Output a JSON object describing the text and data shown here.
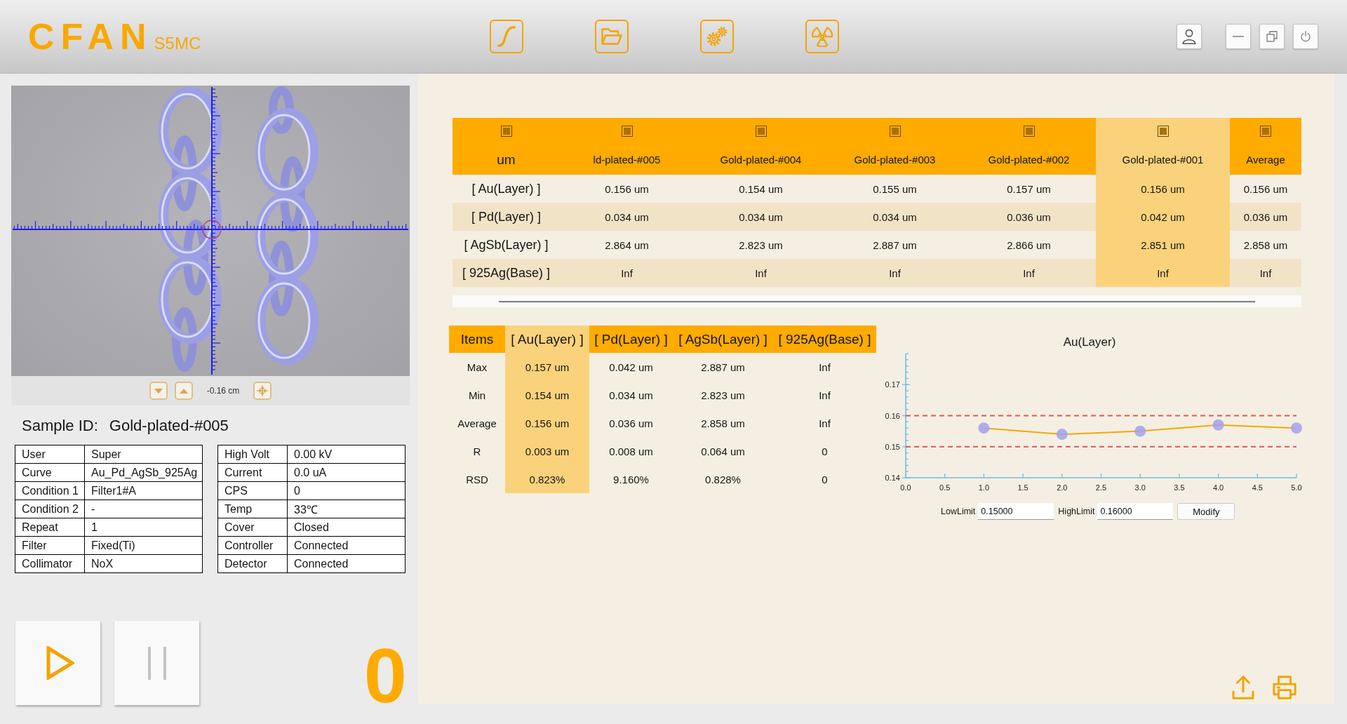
{
  "header": {
    "brand": "CFAN",
    "model": "S5MC"
  },
  "camera": {
    "offset": "-0.16 cm"
  },
  "sample": {
    "label": "Sample ID:",
    "value": "Gold-plated-#005"
  },
  "info_left": [
    {
      "label": "User",
      "value": "Super"
    },
    {
      "label": "Curve",
      "value": "Au_Pd_AgSb_925Ag"
    },
    {
      "label": "Condition 1",
      "value": "Filter1#A"
    },
    {
      "label": "Condition 2",
      "value": "-"
    },
    {
      "label": "Repeat",
      "value": "1"
    },
    {
      "label": "Filter",
      "value": "Fixed(Ti)"
    },
    {
      "label": "Collimator",
      "value": "NoX"
    }
  ],
  "info_right": [
    {
      "label": "High Volt",
      "value": "0.00 kV"
    },
    {
      "label": "Current",
      "value": "0.0 uA"
    },
    {
      "label": "CPS",
      "value": "0"
    },
    {
      "label": "Temp",
      "value": "33℃"
    },
    {
      "label": "Cover",
      "value": "Closed"
    },
    {
      "label": "Controller",
      "value": "Connected"
    },
    {
      "label": "Detector",
      "value": "Connected"
    }
  ],
  "run_controls": [
    {
      "kind": "play",
      "disabled": false
    },
    {
      "kind": "pause",
      "disabled": true
    }
  ],
  "counter": "0",
  "results_table": {
    "columns": [
      {
        "label": "um",
        "checked": true,
        "selected": false
      },
      {
        "label": "ld-plated-#005",
        "checked": true,
        "selected": false
      },
      {
        "label": "Gold-plated-#004",
        "checked": true,
        "selected": false
      },
      {
        "label": "Gold-plated-#003",
        "checked": true,
        "selected": false
      },
      {
        "label": "Gold-plated-#002",
        "checked": true,
        "selected": false
      },
      {
        "label": "Gold-plated-#001",
        "checked": true,
        "selected": true
      },
      {
        "label": "Average",
        "checked": true,
        "selected": false
      }
    ],
    "rows": [
      {
        "label": "[ Au(Layer) ]",
        "values": [
          "0.156 um",
          "0.154 um",
          "0.155 um",
          "0.157 um",
          "0.156 um",
          "0.156 um"
        ]
      },
      {
        "label": "[ Pd(Layer) ]",
        "values": [
          "0.034 um",
          "0.034 um",
          "0.034 um",
          "0.036 um",
          "0.042 um",
          "0.036 um"
        ]
      },
      {
        "label": "[ AgSb(Layer) ]",
        "values": [
          "2.864 um",
          "2.823 um",
          "2.887 um",
          "2.866 um",
          "2.851 um",
          "2.858 um"
        ]
      },
      {
        "label": "[ 925Ag(Base) ]",
        "values": [
          "Inf",
          "Inf",
          "Inf",
          "Inf",
          "Inf",
          "Inf"
        ]
      }
    ]
  },
  "stats_table": {
    "columns": [
      {
        "label": "Items",
        "selected": false
      },
      {
        "label": "[ Au(Layer) ]",
        "selected": true
      },
      {
        "label": "[ Pd(Layer) ]",
        "selected": false
      },
      {
        "label": "[ AgSb(Layer) ]",
        "selected": false
      },
      {
        "label": "[ 925Ag(Base) ]",
        "selected": false
      }
    ],
    "rows": [
      {
        "label": "Max",
        "values": [
          "0.157 um",
          "0.042 um",
          "2.887 um",
          "Inf"
        ]
      },
      {
        "label": "Min",
        "values": [
          "0.154 um",
          "0.034 um",
          "2.823 um",
          "Inf"
        ]
      },
      {
        "label": "Average",
        "values": [
          "0.156 um",
          "0.036 um",
          "2.858 um",
          "Inf"
        ]
      },
      {
        "label": "R",
        "values": [
          "0.003 um",
          "0.008 um",
          "0.064 um",
          "0"
        ]
      },
      {
        "label": "RSD",
        "values": [
          "0.823%",
          "9.160%",
          "0.828%",
          "0"
        ]
      }
    ]
  },
  "chart": {
    "chart_data": {
      "type": "line",
      "title": "Au(Layer)",
      "x": [
        1,
        2,
        3,
        4,
        5
      ],
      "series": [
        {
          "color": "#f5a800",
          "marker": "circle",
          "values": [
            0.156,
            0.154,
            0.155,
            0.157,
            0.156
          ]
        }
      ],
      "xlim": [
        0,
        5
      ],
      "ylim": [
        0.14,
        0.18
      ],
      "xticks": [
        {
          "value": 0,
          "label": "0.0"
        },
        {
          "value": 0.5,
          "label": "0.5"
        },
        {
          "value": 1,
          "label": "1.0"
        },
        {
          "value": 1.5,
          "label": "1.5"
        },
        {
          "value": 2,
          "label": "2.0"
        },
        {
          "value": 2.5,
          "label": "2.5"
        },
        {
          "value": 3,
          "label": "3.0"
        },
        {
          "value": 3.5,
          "label": "3.5"
        },
        {
          "value": 4,
          "label": "4.0"
        },
        {
          "value": 4.5,
          "label": "4.5"
        },
        {
          "value": 5,
          "label": "5.0"
        }
      ],
      "yticks": [
        0.14,
        0.15,
        0.16,
        0.17
      ],
      "ref_lines": [
        {
          "axis": "y",
          "value": 0.16,
          "color": "#e05656"
        },
        {
          "axis": "y",
          "value": 0.15,
          "color": "#e05656"
        }
      ]
    }
  },
  "limits": {
    "low_label": "LowLimit",
    "low_value": "0.15000",
    "high_label": "HighLimit",
    "high_value": "0.16000",
    "button": "Modify"
  }
}
